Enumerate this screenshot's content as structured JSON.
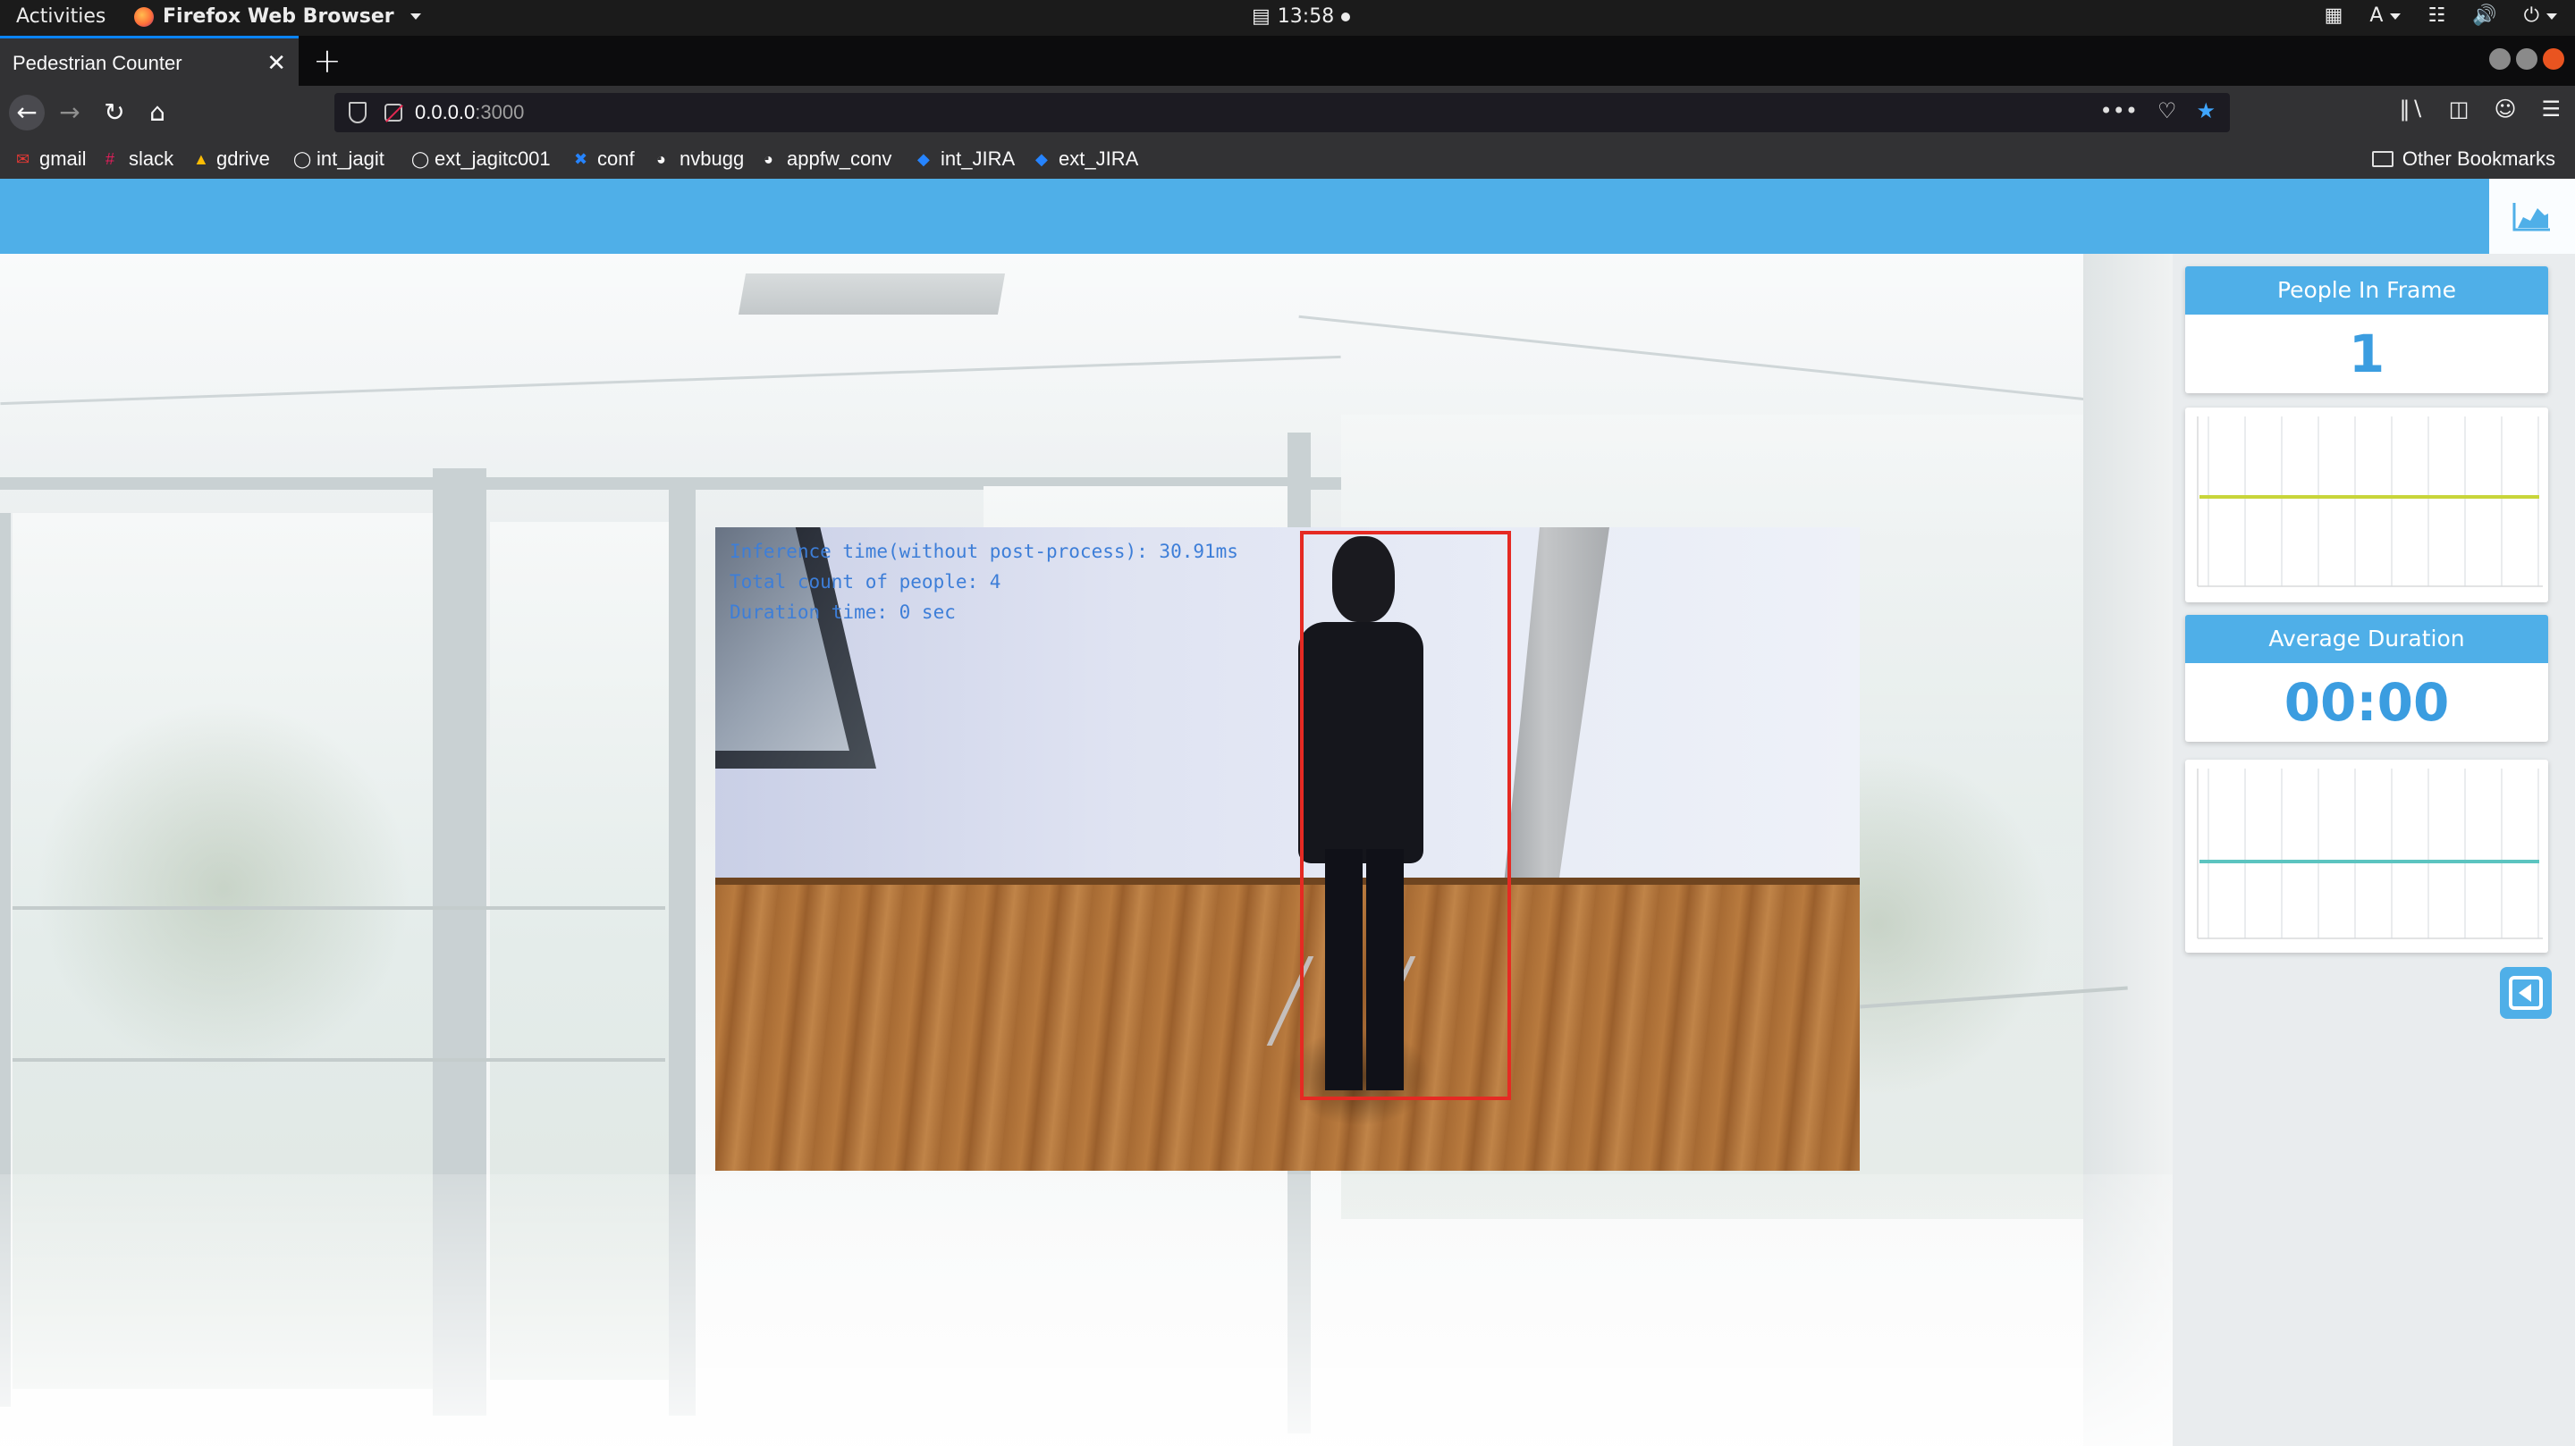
{
  "gnome": {
    "activities": "Activities",
    "app_name": "Firefox Web Browser",
    "clock": "13:58",
    "keyboard_layout": "A"
  },
  "browser": {
    "tab_title": "Pedestrian Counter",
    "url_host": "0.0.0.0",
    "url_port": ":3000",
    "page_actions_more": "•••",
    "bookmarks": [
      {
        "label": "gmail",
        "icon": "gmail-icon",
        "color": "#e53935"
      },
      {
        "label": "slack",
        "icon": "slack-icon",
        "color": "#e01e5a"
      },
      {
        "label": "gdrive",
        "icon": "gdrive-icon",
        "color": "#fbbc04"
      },
      {
        "label": "int_jagit",
        "icon": "github-icon",
        "color": "#ffffff"
      },
      {
        "label": "ext_jagitc001",
        "icon": "github-icon",
        "color": "#ffffff"
      },
      {
        "label": "conf",
        "icon": "confluence-icon",
        "color": "#2684ff"
      },
      {
        "label": "nvbugg",
        "icon": "globe-icon",
        "color": "#ffffff"
      },
      {
        "label": "appfw_conv",
        "icon": "globe-icon",
        "color": "#ffffff"
      },
      {
        "label": "int_JIRA",
        "icon": "jira-icon",
        "color": "#2684ff"
      },
      {
        "label": "ext_JIRA",
        "icon": "jira-icon",
        "color": "#2684ff"
      }
    ],
    "other_bookmarks": "Other Bookmarks"
  },
  "app": {
    "accent_color": "#4fafe8",
    "video": {
      "overlay_lines": [
        "Inference time(without post-process): 30.91ms",
        "Total count of people: 4",
        "Duration time: 0 sec"
      ],
      "bbox_color": "#e52a23"
    },
    "stats": {
      "people_in_frame": {
        "label": "People In Frame",
        "value": "1"
      },
      "average_duration": {
        "label": "Average Duration",
        "value": "00:00"
      }
    },
    "charts": [
      {
        "name": "people-in-frame-chart",
        "line_color": "#c8d53a"
      },
      {
        "name": "average-duration-chart",
        "line_color": "#5cc4c0"
      }
    ]
  }
}
